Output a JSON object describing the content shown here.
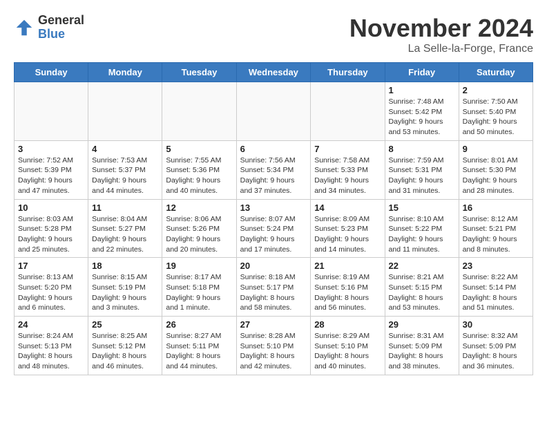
{
  "logo": {
    "general": "General",
    "blue": "Blue"
  },
  "title": "November 2024",
  "location": "La Selle-la-Forge, France",
  "weekdays": [
    "Sunday",
    "Monday",
    "Tuesday",
    "Wednesday",
    "Thursday",
    "Friday",
    "Saturday"
  ],
  "weeks": [
    [
      {
        "day": "",
        "info": ""
      },
      {
        "day": "",
        "info": ""
      },
      {
        "day": "",
        "info": ""
      },
      {
        "day": "",
        "info": ""
      },
      {
        "day": "",
        "info": ""
      },
      {
        "day": "1",
        "info": "Sunrise: 7:48 AM\nSunset: 5:42 PM\nDaylight: 9 hours and 53 minutes."
      },
      {
        "day": "2",
        "info": "Sunrise: 7:50 AM\nSunset: 5:40 PM\nDaylight: 9 hours and 50 minutes."
      }
    ],
    [
      {
        "day": "3",
        "info": "Sunrise: 7:52 AM\nSunset: 5:39 PM\nDaylight: 9 hours and 47 minutes."
      },
      {
        "day": "4",
        "info": "Sunrise: 7:53 AM\nSunset: 5:37 PM\nDaylight: 9 hours and 44 minutes."
      },
      {
        "day": "5",
        "info": "Sunrise: 7:55 AM\nSunset: 5:36 PM\nDaylight: 9 hours and 40 minutes."
      },
      {
        "day": "6",
        "info": "Sunrise: 7:56 AM\nSunset: 5:34 PM\nDaylight: 9 hours and 37 minutes."
      },
      {
        "day": "7",
        "info": "Sunrise: 7:58 AM\nSunset: 5:33 PM\nDaylight: 9 hours and 34 minutes."
      },
      {
        "day": "8",
        "info": "Sunrise: 7:59 AM\nSunset: 5:31 PM\nDaylight: 9 hours and 31 minutes."
      },
      {
        "day": "9",
        "info": "Sunrise: 8:01 AM\nSunset: 5:30 PM\nDaylight: 9 hours and 28 minutes."
      }
    ],
    [
      {
        "day": "10",
        "info": "Sunrise: 8:03 AM\nSunset: 5:28 PM\nDaylight: 9 hours and 25 minutes."
      },
      {
        "day": "11",
        "info": "Sunrise: 8:04 AM\nSunset: 5:27 PM\nDaylight: 9 hours and 22 minutes."
      },
      {
        "day": "12",
        "info": "Sunrise: 8:06 AM\nSunset: 5:26 PM\nDaylight: 9 hours and 20 minutes."
      },
      {
        "day": "13",
        "info": "Sunrise: 8:07 AM\nSunset: 5:24 PM\nDaylight: 9 hours and 17 minutes."
      },
      {
        "day": "14",
        "info": "Sunrise: 8:09 AM\nSunset: 5:23 PM\nDaylight: 9 hours and 14 minutes."
      },
      {
        "day": "15",
        "info": "Sunrise: 8:10 AM\nSunset: 5:22 PM\nDaylight: 9 hours and 11 minutes."
      },
      {
        "day": "16",
        "info": "Sunrise: 8:12 AM\nSunset: 5:21 PM\nDaylight: 9 hours and 8 minutes."
      }
    ],
    [
      {
        "day": "17",
        "info": "Sunrise: 8:13 AM\nSunset: 5:20 PM\nDaylight: 9 hours and 6 minutes."
      },
      {
        "day": "18",
        "info": "Sunrise: 8:15 AM\nSunset: 5:19 PM\nDaylight: 9 hours and 3 minutes."
      },
      {
        "day": "19",
        "info": "Sunrise: 8:17 AM\nSunset: 5:18 PM\nDaylight: 9 hours and 1 minute."
      },
      {
        "day": "20",
        "info": "Sunrise: 8:18 AM\nSunset: 5:17 PM\nDaylight: 8 hours and 58 minutes."
      },
      {
        "day": "21",
        "info": "Sunrise: 8:19 AM\nSunset: 5:16 PM\nDaylight: 8 hours and 56 minutes."
      },
      {
        "day": "22",
        "info": "Sunrise: 8:21 AM\nSunset: 5:15 PM\nDaylight: 8 hours and 53 minutes."
      },
      {
        "day": "23",
        "info": "Sunrise: 8:22 AM\nSunset: 5:14 PM\nDaylight: 8 hours and 51 minutes."
      }
    ],
    [
      {
        "day": "24",
        "info": "Sunrise: 8:24 AM\nSunset: 5:13 PM\nDaylight: 8 hours and 48 minutes."
      },
      {
        "day": "25",
        "info": "Sunrise: 8:25 AM\nSunset: 5:12 PM\nDaylight: 8 hours and 46 minutes."
      },
      {
        "day": "26",
        "info": "Sunrise: 8:27 AM\nSunset: 5:11 PM\nDaylight: 8 hours and 44 minutes."
      },
      {
        "day": "27",
        "info": "Sunrise: 8:28 AM\nSunset: 5:10 PM\nDaylight: 8 hours and 42 minutes."
      },
      {
        "day": "28",
        "info": "Sunrise: 8:29 AM\nSunset: 5:10 PM\nDaylight: 8 hours and 40 minutes."
      },
      {
        "day": "29",
        "info": "Sunrise: 8:31 AM\nSunset: 5:09 PM\nDaylight: 8 hours and 38 minutes."
      },
      {
        "day": "30",
        "info": "Sunrise: 8:32 AM\nSunset: 5:09 PM\nDaylight: 8 hours and 36 minutes."
      }
    ]
  ]
}
